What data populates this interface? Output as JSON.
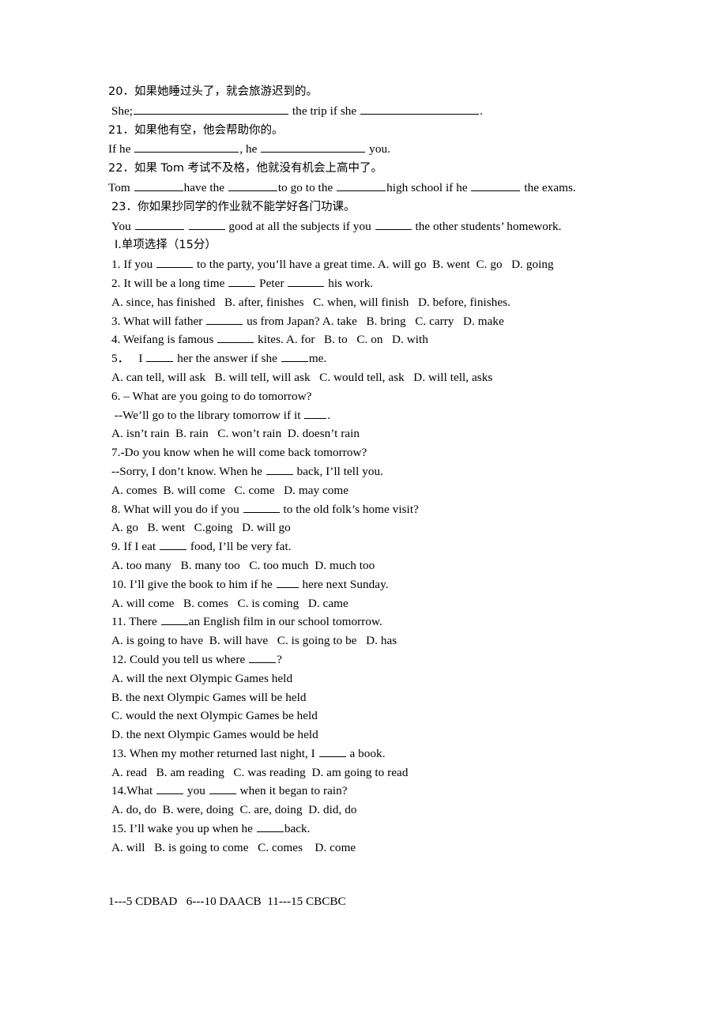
{
  "document": {
    "type": "english-exam-worksheet",
    "language": "zh-CN/en"
  },
  "translation_section": {
    "items": [
      {
        "number": "20.",
        "prompt_cn": "20．如果她睡过头了，就会旅游迟到的。",
        "answer_line_parts": [
          " She;",
          " the trip if she ",
          "."
        ]
      },
      {
        "number": "21.",
        "prompt_cn": "21．如果他有空，他会帮助你的。",
        "answer_line_parts": [
          "If he ",
          ", he ",
          " you."
        ]
      },
      {
        "number": "22.",
        "prompt_cn": "22．如果 Tom 考试不及格，他就没有机会上高中了。",
        "answer_line_parts": [
          "Tom ",
          "have the ",
          "to go to the ",
          "high school if he ",
          " the exams."
        ]
      },
      {
        "number": "23.",
        "prompt_cn": "23．你如果抄同学的作业就不能学好各门功课。",
        "answer_line_parts": [
          "You ",
          " ",
          " good at all the subjects if you ",
          " the other students’ homework."
        ]
      }
    ]
  },
  "multiple_choice_section": {
    "heading": "Ⅰ.单项选择（15分）",
    "questions": [
      {
        "stem_before": "1. If you ",
        "stem_after": " to the party, you’ll have a great time. A. will go  B. went  C. go   D. going",
        "options_line": ""
      },
      {
        "stem_before": "2. It will be a long time ",
        "stem_mid": " Peter ",
        "stem_after": " his work.",
        "options_line": "A. since, has finished   B. after, finishes   C. when, will finish   D. before, finishes."
      },
      {
        "stem_before": "3. What will father ",
        "stem_after": " us from Japan? A. take   B. bring   C. carry   D. make",
        "options_line": ""
      },
      {
        "stem_before": "4. Weifang is famous ",
        "stem_after": " kites. A. for   B. to   C. on   D. with",
        "options_line": ""
      },
      {
        "stem_before": "5．   I ",
        "stem_after": " her the answer if she ",
        "stem_tail": "me.",
        "options_line": "A. can tell, will ask   B. will tell, will ask   C. would tell, ask   D. will tell, asks"
      },
      {
        "stem_line1": "6. – What are you going to do tomorrow?",
        "stem_line2_before": " --We’ll go to the library tomorrow if it ",
        "stem_line2_after": ".",
        "options_line": "A. isn’t rain  B. rain   C. won’t rain  D. doesn’t rain"
      },
      {
        "stem_line1": "7.-Do you know when he will come back tomorrow?",
        "stem_line2_before": "--Sorry, I don’t know. When he ",
        "stem_line2_after": " back, I’ll tell you.",
        "options_line": "A. comes  B. will come   C. come   D. may come"
      },
      {
        "stem_before": "8. What will you do if you ",
        "stem_after": " to the old folk’s home visit?",
        "options_line": "A. go   B. went   C.going   D. will go"
      },
      {
        "stem_before": "9. If I eat ",
        "stem_after": " food, I’ll be very fat.",
        "options_line": "A. too many   B. many too   C. too much  D. much too"
      },
      {
        "stem_before": "10. I’ll give the book to him if he ",
        "stem_after": " here next Sunday.",
        "options_line": "A. will come   B. comes   C. is coming   D. came"
      },
      {
        "stem_before": "11. There ",
        "stem_after": "an English film in our school tomorrow.",
        "options_line": "A. is going to have  B. will have   C. is going to be   D. has"
      },
      {
        "stem_before": "12. Could you tell us where ",
        "stem_after": "?",
        "options_stacked": [
          "A. will the next Olympic Games held",
          "B. the next Olympic Games will be held",
          "C. would the next Olympic Games be held",
          "D. the next Olympic Games would be held"
        ]
      },
      {
        "stem_before": "13. When my mother returned last night, I ",
        "stem_after": " a book.",
        "options_line": "A. read   B. am reading   C. was reading  D. am going to read"
      },
      {
        "stem_before": "14.What ",
        "stem_mid": " you ",
        "stem_after": " when it began to rain?",
        "options_line": "A. do, do  B. were, doing  C. are, doing  D. did, do"
      },
      {
        "stem_before": "15. I’ll wake you up when he ",
        "stem_after": "back.",
        "options_line": "A. will   B. is going to come   C. comes    D. come"
      }
    ]
  },
  "answer_key": {
    "line": "1---5 CDBAD   6---10 DAACB  11---15 CBCBC"
  }
}
